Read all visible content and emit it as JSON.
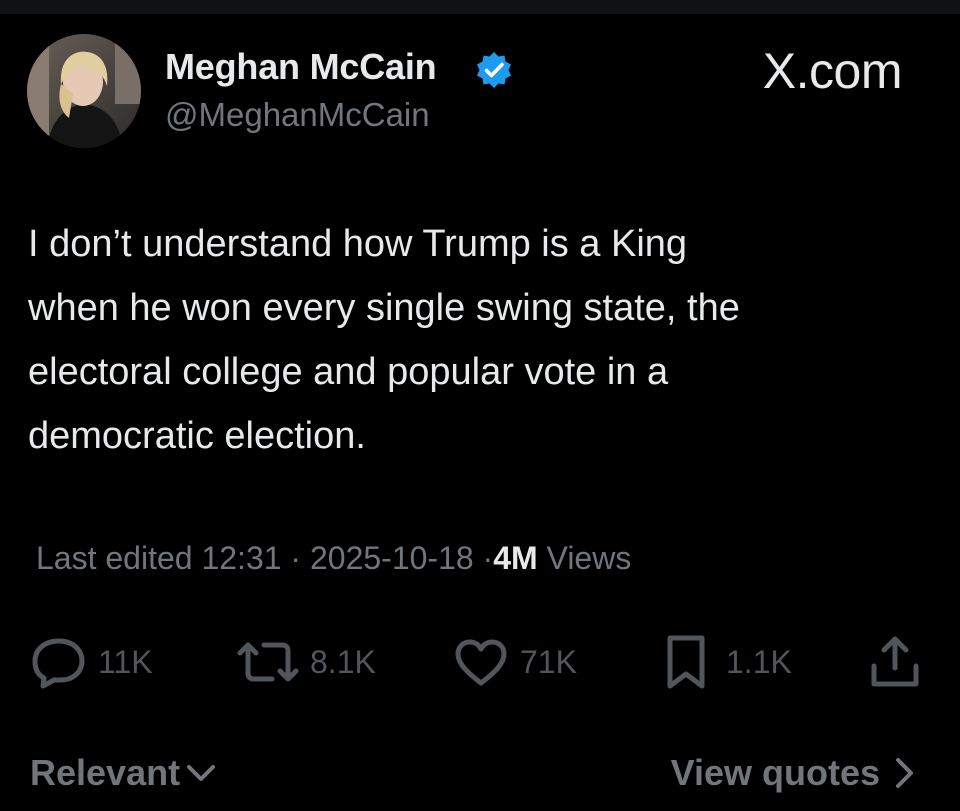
{
  "author": {
    "display_name": "Meghan McCain",
    "handle": "@MeghanMcCain",
    "verified_icon": "verified-badge-icon",
    "verified_color": "#1d9bf0"
  },
  "site_label": "X.com",
  "tweet": {
    "lines": [
      "I don’t understand how Trump is a King",
      "when he won every single swing state, the",
      "electoral college and popular vote in a",
      "democratic election."
    ]
  },
  "meta": {
    "edited_label": "Last edited",
    "time": "12:31",
    "separator": "·",
    "date": "2025-10-18",
    "views_count": "4M",
    "views_label": "Views"
  },
  "actions": {
    "replies": "11K",
    "reposts": "8.1K",
    "likes": "71K",
    "bookmarks": "1.1K"
  },
  "footer": {
    "sort_label": "Relevant",
    "view_quotes_label": "View quotes"
  },
  "colors": {
    "background": "#000000",
    "primary_text": "#e7e9ea",
    "secondary_text": "#71767b",
    "action_icons": "#51565a"
  }
}
